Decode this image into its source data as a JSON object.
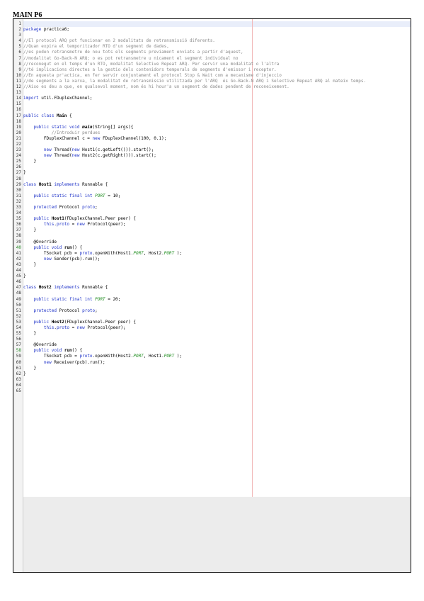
{
  "title": "MAIN P6",
  "lines": [
    {
      "n": "1",
      "seg": []
    },
    {
      "n": "2",
      "seg": [
        [
          "kw",
          "package"
        ],
        [
          "",
          "practica6;"
        ]
      ]
    },
    {
      "n": "3",
      "seg": []
    },
    {
      "n": "4",
      "seg": [
        [
          "cm",
          "//El protocol ARQ pot funcionar en 2 modalitats de retransmissió diferents."
        ]
      ]
    },
    {
      "n": "5",
      "seg": [
        [
          "cm",
          "//Quan expira el temporitzador RTO d'un segment de dades,"
        ]
      ]
    },
    {
      "n": "6",
      "seg": [
        [
          "cm",
          "//es poden retransmetre de nou tots els segments previament enviats a partir d'aquest,"
        ]
      ]
    },
    {
      "n": "7",
      "seg": [
        [
          "cm",
          "//modalitat Go-Back-N ARQ; o es pot retransmetre u nicament el segment individual no"
        ]
      ]
    },
    {
      "n": "8",
      "seg": [
        [
          "cm",
          "//reconegut en el temps d'un RTO, modalitat Selective Repeat ARQ. Per servir una modalitat o l'altra"
        ]
      ]
    },
    {
      "n": "9",
      "seg": [
        [
          "cm",
          "//té implicacions directes a la gestio dels contenidors temporals de segments d'emissor i receptor."
        ]
      ]
    },
    {
      "n": "10",
      "seg": [
        [
          "cm",
          "//En aquesta pr'actica, en fer servir conjuntament el protocol Stop & Wait com a mecanisme d'injeccio"
        ]
      ]
    },
    {
      "n": "11",
      "seg": [
        [
          "cm",
          "//de segments a la xarxa, la modalitat de retransmissio utilitzada per l'ARQ  és Go-Back-N ARQ i Selective Repeat ARQ al mateix temps."
        ]
      ]
    },
    {
      "n": "12",
      "seg": [
        [
          "cm",
          "//Aixo es deu a que, en qualsevol moment, nom és hi hour'a un segment de dades pendent de reconeixement."
        ]
      ]
    },
    {
      "n": "13",
      "seg": []
    },
    {
      "n": "14",
      "seg": [
        [
          "kw",
          "import"
        ],
        [
          "",
          "util.FDuplexChannel;"
        ]
      ]
    },
    {
      "n": "15",
      "seg": []
    },
    {
      "n": "16",
      "seg": []
    },
    {
      "n": "17",
      "seg": [
        [
          "kw",
          "public class"
        ],
        [
          "st",
          "Main"
        ],
        [
          "",
          "{"
        ]
      ]
    },
    {
      "n": "18",
      "seg": []
    },
    {
      "n": "19",
      "seg": [
        [
          "",
          "    "
        ],
        [
          "kw",
          "public static void"
        ],
        [
          "mt",
          "main"
        ],
        [
          "",
          "(String[] args){"
        ]
      ]
    },
    {
      "n": "20",
      "seg": [
        [
          "",
          "           "
        ],
        [
          "cm",
          "//Introduir perdues"
        ]
      ]
    },
    {
      "n": "21",
      "seg": [
        [
          "",
          "        FDuplexChannel c = "
        ],
        [
          "kw",
          "new"
        ],
        [
          "",
          "FDuplexChannel(100, 0.1);"
        ]
      ]
    },
    {
      "n": "22",
      "seg": []
    },
    {
      "n": "23",
      "seg": [
        [
          "",
          "        "
        ],
        [
          "kw",
          "new"
        ],
        [
          "",
          "Thread("
        ],
        [
          "kw",
          "new"
        ],
        [
          "",
          "Host1(c.getLeft())).start();"
        ]
      ]
    },
    {
      "n": "24",
      "seg": [
        [
          "",
          "        "
        ],
        [
          "kw",
          "new"
        ],
        [
          "",
          "Thread("
        ],
        [
          "kw",
          "new"
        ],
        [
          "",
          "Host2(c.getRight())).start();"
        ]
      ]
    },
    {
      "n": "25",
      "seg": [
        [
          "",
          "    }"
        ]
      ]
    },
    {
      "n": "26",
      "seg": []
    },
    {
      "n": "27",
      "seg": [
        [
          "",
          "}"
        ]
      ]
    },
    {
      "n": "28",
      "seg": []
    },
    {
      "n": "29",
      "seg": [
        [
          "kw",
          "class"
        ],
        [
          "st",
          "Host1"
        ],
        [
          "kw",
          "implements"
        ],
        [
          "",
          "Runnable {"
        ]
      ]
    },
    {
      "n": "30",
      "seg": []
    },
    {
      "n": "31",
      "seg": [
        [
          "",
          "    "
        ],
        [
          "kw",
          "public static final int"
        ],
        [
          "cn",
          "PORT"
        ],
        [
          "",
          "= 10;"
        ]
      ]
    },
    {
      "n": "32",
      "seg": []
    },
    {
      "n": "33",
      "seg": [
        [
          "",
          "    "
        ],
        [
          "kw",
          "protected"
        ],
        [
          "",
          "Protocol "
        ],
        [
          "fd",
          "proto"
        ],
        [
          "",
          ";"
        ]
      ]
    },
    {
      "n": "34",
      "seg": []
    },
    {
      "n": "35",
      "seg": [
        [
          "",
          "    "
        ],
        [
          "kw",
          "public"
        ],
        [
          "st",
          "Host1"
        ],
        [
          "",
          "(FDuplexChannel.Peer peer) {"
        ]
      ]
    },
    {
      "n": "36",
      "seg": [
        [
          "",
          "        "
        ],
        [
          "kw",
          "this"
        ],
        [
          "",
          "."
        ],
        [
          "fd",
          "proto"
        ],
        [
          "",
          "= "
        ],
        [
          "kw",
          "new"
        ],
        [
          "",
          "Protocol(peer);"
        ]
      ]
    },
    {
      "n": "37",
      "seg": [
        [
          "",
          "    }"
        ]
      ]
    },
    {
      "n": "38",
      "seg": []
    },
    {
      "n": "39",
      "seg": [
        [
          "",
          "    @Override"
        ]
      ]
    },
    {
      "n": "40",
      "seg": [
        [
          "",
          "    "
        ],
        [
          "kw",
          "public void"
        ],
        [
          "st",
          "run"
        ],
        [
          "",
          "() {"
        ]
      ],
      "warn": true
    },
    {
      "n": "41",
      "seg": [
        [
          "",
          "        TSocket pcb = "
        ],
        [
          "fd",
          "proto"
        ],
        [
          "",
          ".openWith(Host1."
        ],
        [
          "cn",
          "PORT"
        ],
        [
          "",
          ", Host2."
        ],
        [
          "cn",
          "PORT"
        ],
        [
          "",
          ");"
        ]
      ]
    },
    {
      "n": "42",
      "seg": [
        [
          "",
          "        "
        ],
        [
          "kw",
          "new"
        ],
        [
          "",
          "Sender(pcb).run();"
        ]
      ]
    },
    {
      "n": "43",
      "seg": [
        [
          "",
          "    }"
        ]
      ]
    },
    {
      "n": "44",
      "seg": []
    },
    {
      "n": "45",
      "seg": [
        [
          "",
          "}"
        ]
      ]
    },
    {
      "n": "46",
      "seg": []
    },
    {
      "n": "47",
      "seg": [
        [
          "kw",
          "class"
        ],
        [
          "st",
          "Host2"
        ],
        [
          "kw",
          "implements"
        ],
        [
          "",
          "Runnable {"
        ]
      ]
    },
    {
      "n": "48",
      "seg": []
    },
    {
      "n": "49",
      "seg": [
        [
          "",
          "    "
        ],
        [
          "kw",
          "public static final int"
        ],
        [
          "cn",
          "PORT"
        ],
        [
          "",
          "= 20;"
        ]
      ]
    },
    {
      "n": "50",
      "seg": []
    },
    {
      "n": "51",
      "seg": [
        [
          "",
          "    "
        ],
        [
          "kw",
          "protected"
        ],
        [
          "",
          "Protocol "
        ],
        [
          "fd",
          "proto"
        ],
        [
          "",
          ";"
        ]
      ]
    },
    {
      "n": "52",
      "seg": []
    },
    {
      "n": "53",
      "seg": [
        [
          "",
          "    "
        ],
        [
          "kw",
          "public"
        ],
        [
          "st",
          "Host2"
        ],
        [
          "",
          "(FDuplexChannel.Peer peer) {"
        ]
      ]
    },
    {
      "n": "54",
      "seg": [
        [
          "",
          "        "
        ],
        [
          "kw",
          "this"
        ],
        [
          "",
          "."
        ],
        [
          "fd",
          "proto"
        ],
        [
          "",
          "= "
        ],
        [
          "kw",
          "new"
        ],
        [
          "",
          "Protocol(peer);"
        ]
      ]
    },
    {
      "n": "55",
      "seg": [
        [
          "",
          "    }"
        ]
      ]
    },
    {
      "n": "56",
      "seg": []
    },
    {
      "n": "57",
      "seg": [
        [
          "",
          "    @Override"
        ]
      ]
    },
    {
      "n": "58",
      "seg": [
        [
          "",
          "    "
        ],
        [
          "kw",
          "public void"
        ],
        [
          "st",
          "run"
        ],
        [
          "",
          "() {"
        ]
      ],
      "warn": true
    },
    {
      "n": "59",
      "seg": [
        [
          "",
          "        TSocket pcb = "
        ],
        [
          "fd",
          "proto"
        ],
        [
          "",
          ".openWith(Host2."
        ],
        [
          "cn",
          "PORT"
        ],
        [
          "",
          ", Host1."
        ],
        [
          "cn",
          "PORT"
        ],
        [
          "",
          ");"
        ]
      ]
    },
    {
      "n": "60",
      "seg": [
        [
          "",
          "        "
        ],
        [
          "kw",
          "new"
        ],
        [
          "",
          "Receiver(pcb).run();"
        ]
      ]
    },
    {
      "n": "61",
      "seg": [
        [
          "",
          "    }"
        ]
      ]
    },
    {
      "n": "62",
      "seg": [
        [
          "",
          "}"
        ]
      ]
    },
    {
      "n": "63",
      "seg": []
    },
    {
      "n": "64",
      "seg": []
    },
    {
      "n": "65",
      "seg": []
    }
  ]
}
